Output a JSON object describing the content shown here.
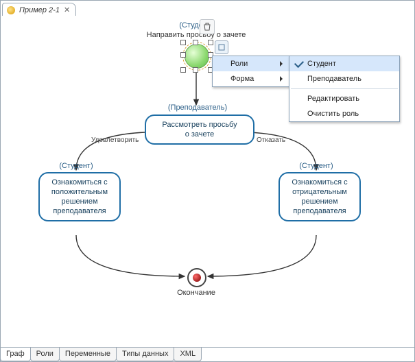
{
  "tabTop": {
    "title": "Пример 2-1",
    "closeGlyph": "✕"
  },
  "topNode": {
    "role": "(Студент)",
    "title": "Направить просьбу о зачете"
  },
  "midNode": {
    "role": "(Преподаватель)",
    "line1": "Рассмотреть просьбу",
    "line2": "о зачете"
  },
  "leftNode": {
    "role": "(Студент)",
    "l1": "Ознакомиться с",
    "l2": "положительным",
    "l3": "решением",
    "l4": "преподавателя"
  },
  "rightNode": {
    "role": "(Студент)",
    "l1": "Ознакомиться с",
    "l2": "отрицательным",
    "l3": "решением",
    "l4": "преподавателя"
  },
  "edges": {
    "left": "Удовлетворить",
    "right": "Отказать"
  },
  "end": {
    "label": "Окончание"
  },
  "ctxMenu": {
    "roles": "Роли",
    "form": "Форма"
  },
  "subMenu": {
    "student": "Студент",
    "teacher": "Преподаватель",
    "edit": "Редактировать",
    "clear": "Очистить роль"
  },
  "bottomTabs": {
    "t1": "Граф",
    "t2": "Роли",
    "t3": "Переменные",
    "t4": "Типы данных",
    "t5": "XML"
  }
}
